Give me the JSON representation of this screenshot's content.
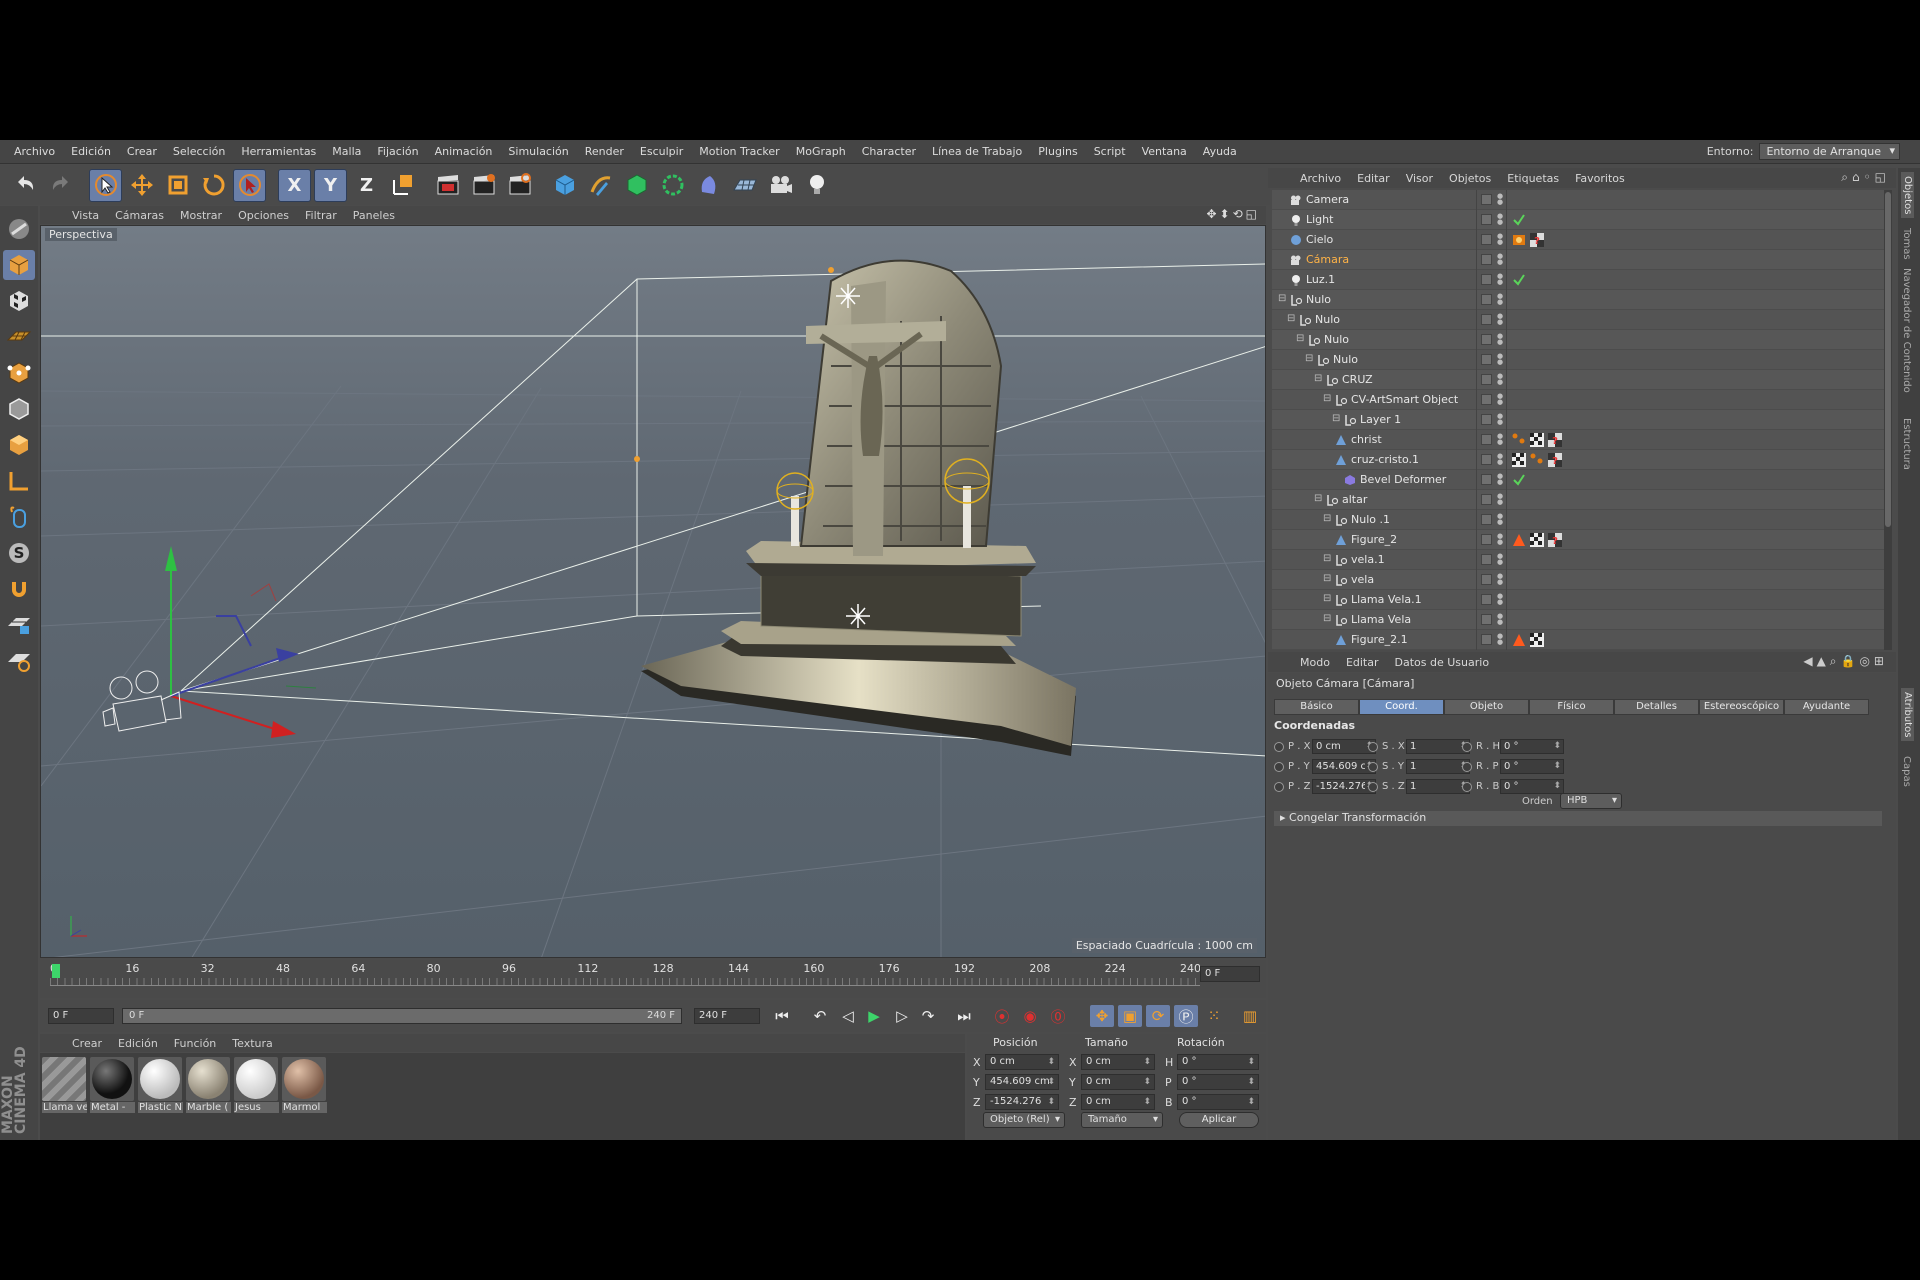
{
  "menubar": {
    "items": [
      "Archivo",
      "Edición",
      "Crear",
      "Selección",
      "Herramientas",
      "Malla",
      "Fijación",
      "Animación",
      "Simulación",
      "Render",
      "Esculpir",
      "Motion Tracker",
      "MoGraph",
      "Character",
      "Línea de Trabajo",
      "Plugins",
      "Script",
      "Ventana",
      "Ayuda"
    ],
    "env_label": "Entorno:",
    "env_value": "Entorno de Arranque"
  },
  "toolbar": {
    "x_label": "X",
    "y_label": "Y",
    "z_label": "Z"
  },
  "viewport": {
    "menu": [
      "Vista",
      "Cámaras",
      "Mostrar",
      "Opciones",
      "Filtrar",
      "Paneles"
    ],
    "label": "Perspectiva",
    "grid": "Espaciado Cuadrícula : 1000 cm"
  },
  "timeline": {
    "ticks": [
      "0",
      "16",
      "32",
      "48",
      "64",
      "80",
      "96",
      "112",
      "128",
      "144",
      "160",
      "176",
      "192",
      "208",
      "224",
      "240"
    ],
    "current_frame": "0 F",
    "start": "0 F",
    "slider_start": "0 F",
    "slider_end": "240 F",
    "end": "240 F"
  },
  "materials": {
    "menu": [
      "Crear",
      "Edición",
      "Función",
      "Textura"
    ],
    "items": [
      {
        "name": "Llama ve",
        "color": "#8c8c8c"
      },
      {
        "name": "Metal -",
        "color": "#1c1c1c"
      },
      {
        "name": "Plastic N",
        "color": "#f2f2f2"
      },
      {
        "name": "Marble (",
        "color": "#b8b0a0"
      },
      {
        "name": "Jesus",
        "color": "#eeeeee"
      },
      {
        "name": "Marmol",
        "color": "#a07d6a"
      }
    ]
  },
  "coords": {
    "headers": {
      "pos": "Posición",
      "size": "Tamaño",
      "rot": "Rotación"
    },
    "rows": [
      {
        "a": "X",
        "pos": "0 cm",
        "b": "X",
        "size": "0 cm",
        "c": "H",
        "rot": "0 °"
      },
      {
        "a": "Y",
        "pos": "454.609 cm",
        "b": "Y",
        "size": "0 cm",
        "c": "P",
        "rot": "0 °"
      },
      {
        "a": "Z",
        "pos": "-1524.276 cm",
        "b": "Z",
        "size": "0 cm",
        "c": "B",
        "rot": "0 °"
      }
    ],
    "mode": "Objeto (Rel)",
    "size_mode": "Tamaño",
    "apply": "Aplicar"
  },
  "objects": {
    "menu": [
      "Archivo",
      "Editar",
      "Visor",
      "Objetos",
      "Etiquetas",
      "Favoritos"
    ],
    "items": [
      {
        "name": "Camera",
        "depth": 0,
        "icon": "camera"
      },
      {
        "name": "Light",
        "depth": 0,
        "icon": "light"
      },
      {
        "name": "Cielo",
        "depth": 0,
        "icon": "sky"
      },
      {
        "name": "Cámara",
        "depth": 0,
        "icon": "camera",
        "selected": true
      },
      {
        "name": "Luz.1",
        "depth": 0,
        "icon": "light"
      },
      {
        "name": "Nulo",
        "depth": 0,
        "icon": "null"
      },
      {
        "name": "Nulo",
        "depth": 1,
        "icon": "null"
      },
      {
        "name": "Nulo",
        "depth": 2,
        "icon": "null"
      },
      {
        "name": "Nulo",
        "depth": 3,
        "icon": "null"
      },
      {
        "name": "CRUZ",
        "depth": 4,
        "icon": "null"
      },
      {
        "name": "CV-ArtSmart Object",
        "depth": 5,
        "icon": "null"
      },
      {
        "name": "Layer 1",
        "depth": 6,
        "icon": "null"
      },
      {
        "name": "christ",
        "depth": 5,
        "icon": "poly"
      },
      {
        "name": "cruz-cristo.1",
        "depth": 5,
        "icon": "poly"
      },
      {
        "name": "Bevel Deformer",
        "depth": 6,
        "icon": "deformer"
      },
      {
        "name": "altar",
        "depth": 4,
        "icon": "null"
      },
      {
        "name": "Nulo .1",
        "depth": 5,
        "icon": "null"
      },
      {
        "name": "Figure_2",
        "depth": 5,
        "icon": "poly"
      },
      {
        "name": "vela.1",
        "depth": 5,
        "icon": "null"
      },
      {
        "name": "vela",
        "depth": 5,
        "icon": "null"
      },
      {
        "name": "Llama Vela.1",
        "depth": 5,
        "icon": "null"
      },
      {
        "name": "Llama Vela",
        "depth": 5,
        "icon": "null"
      },
      {
        "name": "Figure_2.1",
        "depth": 5,
        "icon": "poly"
      }
    ]
  },
  "attributes": {
    "menu": [
      "Modo",
      "Editar",
      "Datos de Usuario"
    ],
    "title": "Objeto Cámara [Cámara]",
    "tabs": [
      "Básico",
      "Coord.",
      "Objeto",
      "Físico",
      "Detalles",
      "Estereoscópico",
      "Ayudante"
    ],
    "section": "Coordenadas",
    "rows": [
      {
        "p": "P . X",
        "pv": "0 cm",
        "s": "S . X",
        "sv": "1",
        "r": "R . H",
        "rv": "0 °"
      },
      {
        "p": "P . Y",
        "pv": "454.609 cm",
        "s": "S . Y",
        "sv": "1",
        "r": "R . P",
        "rv": "0 °"
      },
      {
        "p": "P . Z",
        "pv": "-1524.276 cm",
        "s": "S . Z",
        "sv": "1",
        "r": "R . B",
        "rv": "0 °"
      }
    ],
    "order_label": "Orden",
    "order_value": "HPB",
    "freeze": "Congelar Transformación"
  },
  "right_tabs": [
    "Objetos",
    "Tomas",
    "Navegador de Contenido",
    "Estructura",
    "Atributos",
    "Capas"
  ],
  "logo": "MAXON CINEMA 4D"
}
